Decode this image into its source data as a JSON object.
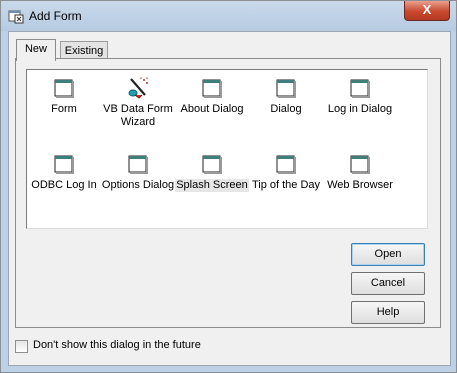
{
  "window": {
    "title": "Add Form",
    "close_label": "X"
  },
  "tabs": [
    {
      "label": "New"
    },
    {
      "label": "Existing"
    }
  ],
  "items": [
    {
      "label": "Form",
      "icon": "form-icon"
    },
    {
      "label": "VB Data Form Wizard",
      "icon": "wizard-wand-icon"
    },
    {
      "label": "About Dialog",
      "icon": "form-icon"
    },
    {
      "label": "Dialog",
      "icon": "form-icon"
    },
    {
      "label": "Log in Dialog",
      "icon": "form-icon"
    },
    {
      "label": "ODBC Log In",
      "icon": "form-icon"
    },
    {
      "label": "Options Dialog",
      "icon": "form-icon"
    },
    {
      "label": "Splash Screen",
      "icon": "form-icon",
      "selected": true
    },
    {
      "label": "Tip of the Day",
      "icon": "form-icon"
    },
    {
      "label": "Web Browser",
      "icon": "form-icon"
    }
  ],
  "buttons": {
    "open": "Open",
    "cancel": "Cancel",
    "help": "Help"
  },
  "footer": {
    "checkbox_label": "Don't show this dialog in the future",
    "checked": false
  }
}
